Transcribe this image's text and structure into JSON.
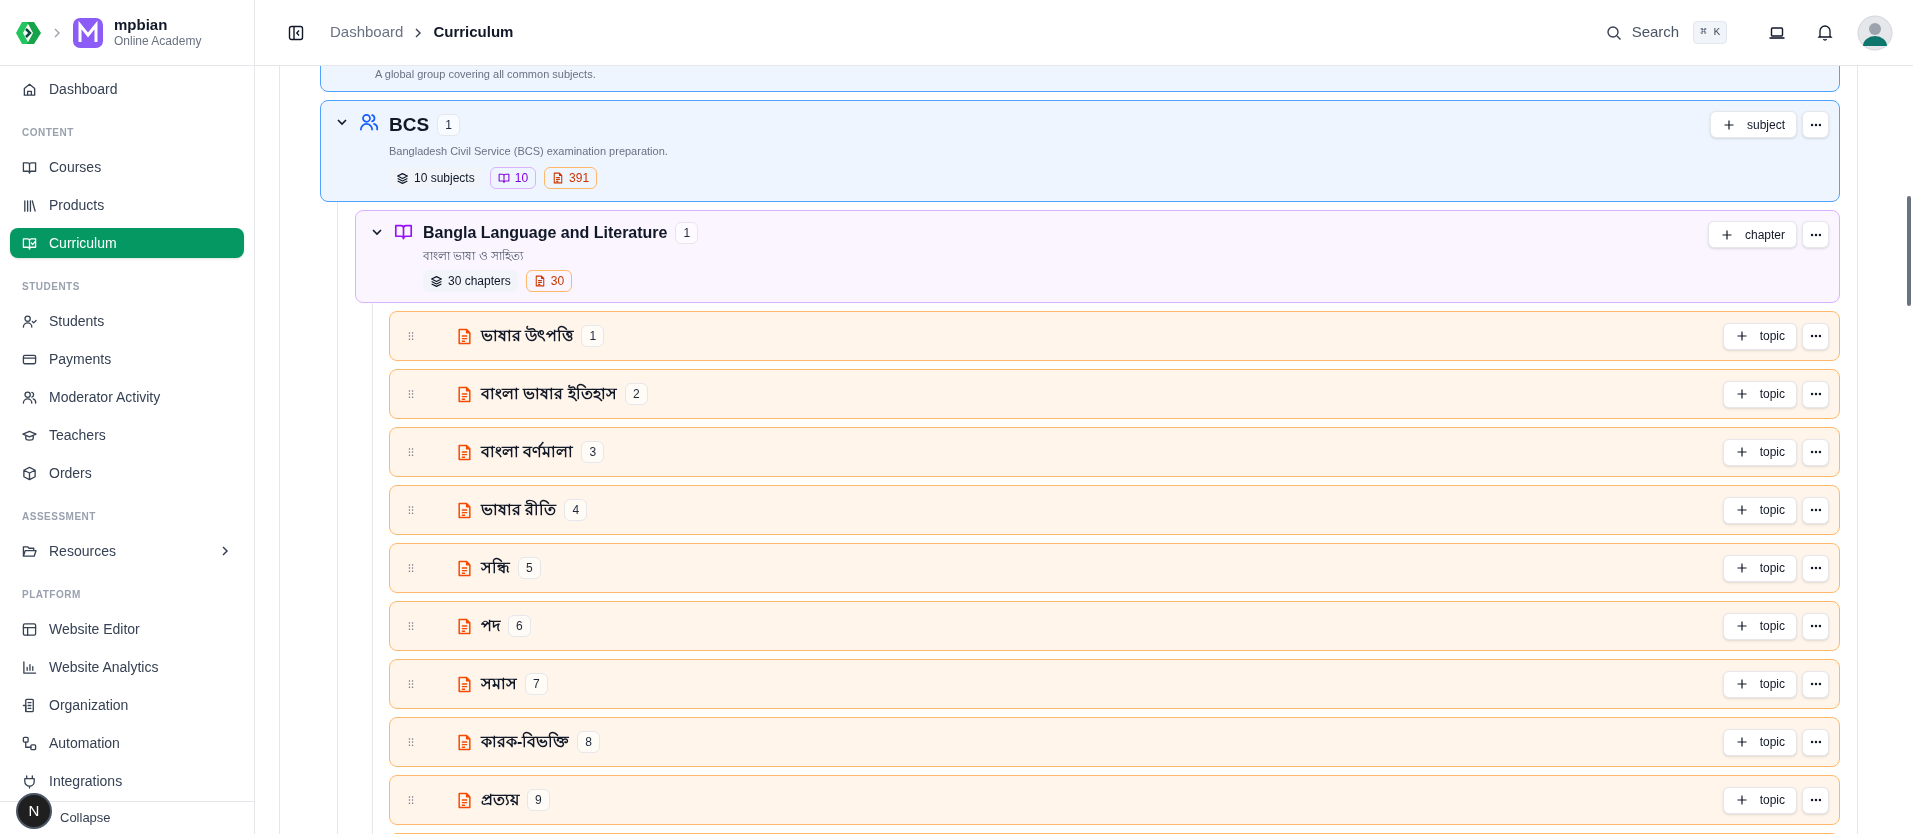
{
  "brand": {
    "name": "mpbian",
    "subtitle": "Online Academy"
  },
  "sidebar": {
    "sections": [
      {
        "items": [
          {
            "label": "Dashboard",
            "selected": false
          }
        ]
      },
      {
        "title": "CONTENT",
        "items": [
          {
            "label": "Courses",
            "selected": false
          },
          {
            "label": "Products",
            "selected": false
          },
          {
            "label": "Curriculum",
            "selected": true
          }
        ]
      },
      {
        "title": "STUDENTS",
        "items": [
          {
            "label": "Students",
            "selected": false
          },
          {
            "label": "Payments",
            "selected": false
          },
          {
            "label": "Moderator Activity",
            "selected": false
          },
          {
            "label": "Teachers",
            "selected": false
          },
          {
            "label": "Orders",
            "selected": false
          }
        ]
      },
      {
        "title": "ASSESSMENT",
        "items": [
          {
            "label": "Resources",
            "selected": false,
            "expandable": true
          }
        ]
      },
      {
        "title": "PLATFORM",
        "items": [
          {
            "label": "Website Editor",
            "selected": false
          },
          {
            "label": "Website Analytics",
            "selected": false
          },
          {
            "label": "Organization",
            "selected": false
          },
          {
            "label": "Automation",
            "selected": false
          },
          {
            "label": "Integrations",
            "selected": false
          }
        ]
      }
    ],
    "footer": {
      "label": "Collapse"
    }
  },
  "dev_badge": "N",
  "breadcrumb": [
    "Dashboard",
    "Curriculum"
  ],
  "search": {
    "label": "Search",
    "shortcut": "⌘ K"
  },
  "tree": {
    "previous_group": {
      "description": "A global group covering all common subjects."
    },
    "group": {
      "name": "BCS",
      "count": "1",
      "expanded": true,
      "description": "Bangladesh Civil Service (BCS) examination preparation.",
      "stats": {
        "subjects": "10 subjects",
        "courses": "10",
        "resources": "391"
      },
      "add_label": "subject",
      "subject": {
        "name": "Bangla Language and Literature",
        "count": "1",
        "expanded": true,
        "description": "বাংলা ভাষা ও সাহিত্য",
        "stats": {
          "chapters": "30 chapters",
          "resources": "30"
        },
        "add_label": "chapter",
        "chapters": [
          {
            "name": "ভাষার উৎপত্তি",
            "count": "1",
            "add_label": "topic"
          },
          {
            "name": "বাংলা ভাষার ইতিহাস",
            "count": "2",
            "add_label": "topic"
          },
          {
            "name": "বাংলা বর্ণমালা",
            "count": "3",
            "add_label": "topic"
          },
          {
            "name": "ভাষার রীতি",
            "count": "4",
            "add_label": "topic"
          },
          {
            "name": "সন্ধি",
            "count": "5",
            "add_label": "topic"
          },
          {
            "name": "পদ",
            "count": "6",
            "add_label": "topic"
          },
          {
            "name": "সমাস",
            "count": "7",
            "add_label": "topic"
          },
          {
            "name": "কারক-বিভক্তি",
            "count": "8",
            "add_label": "topic"
          },
          {
            "name": "প্রত্যয়",
            "count": "9",
            "add_label": "topic"
          }
        ]
      }
    }
  }
}
